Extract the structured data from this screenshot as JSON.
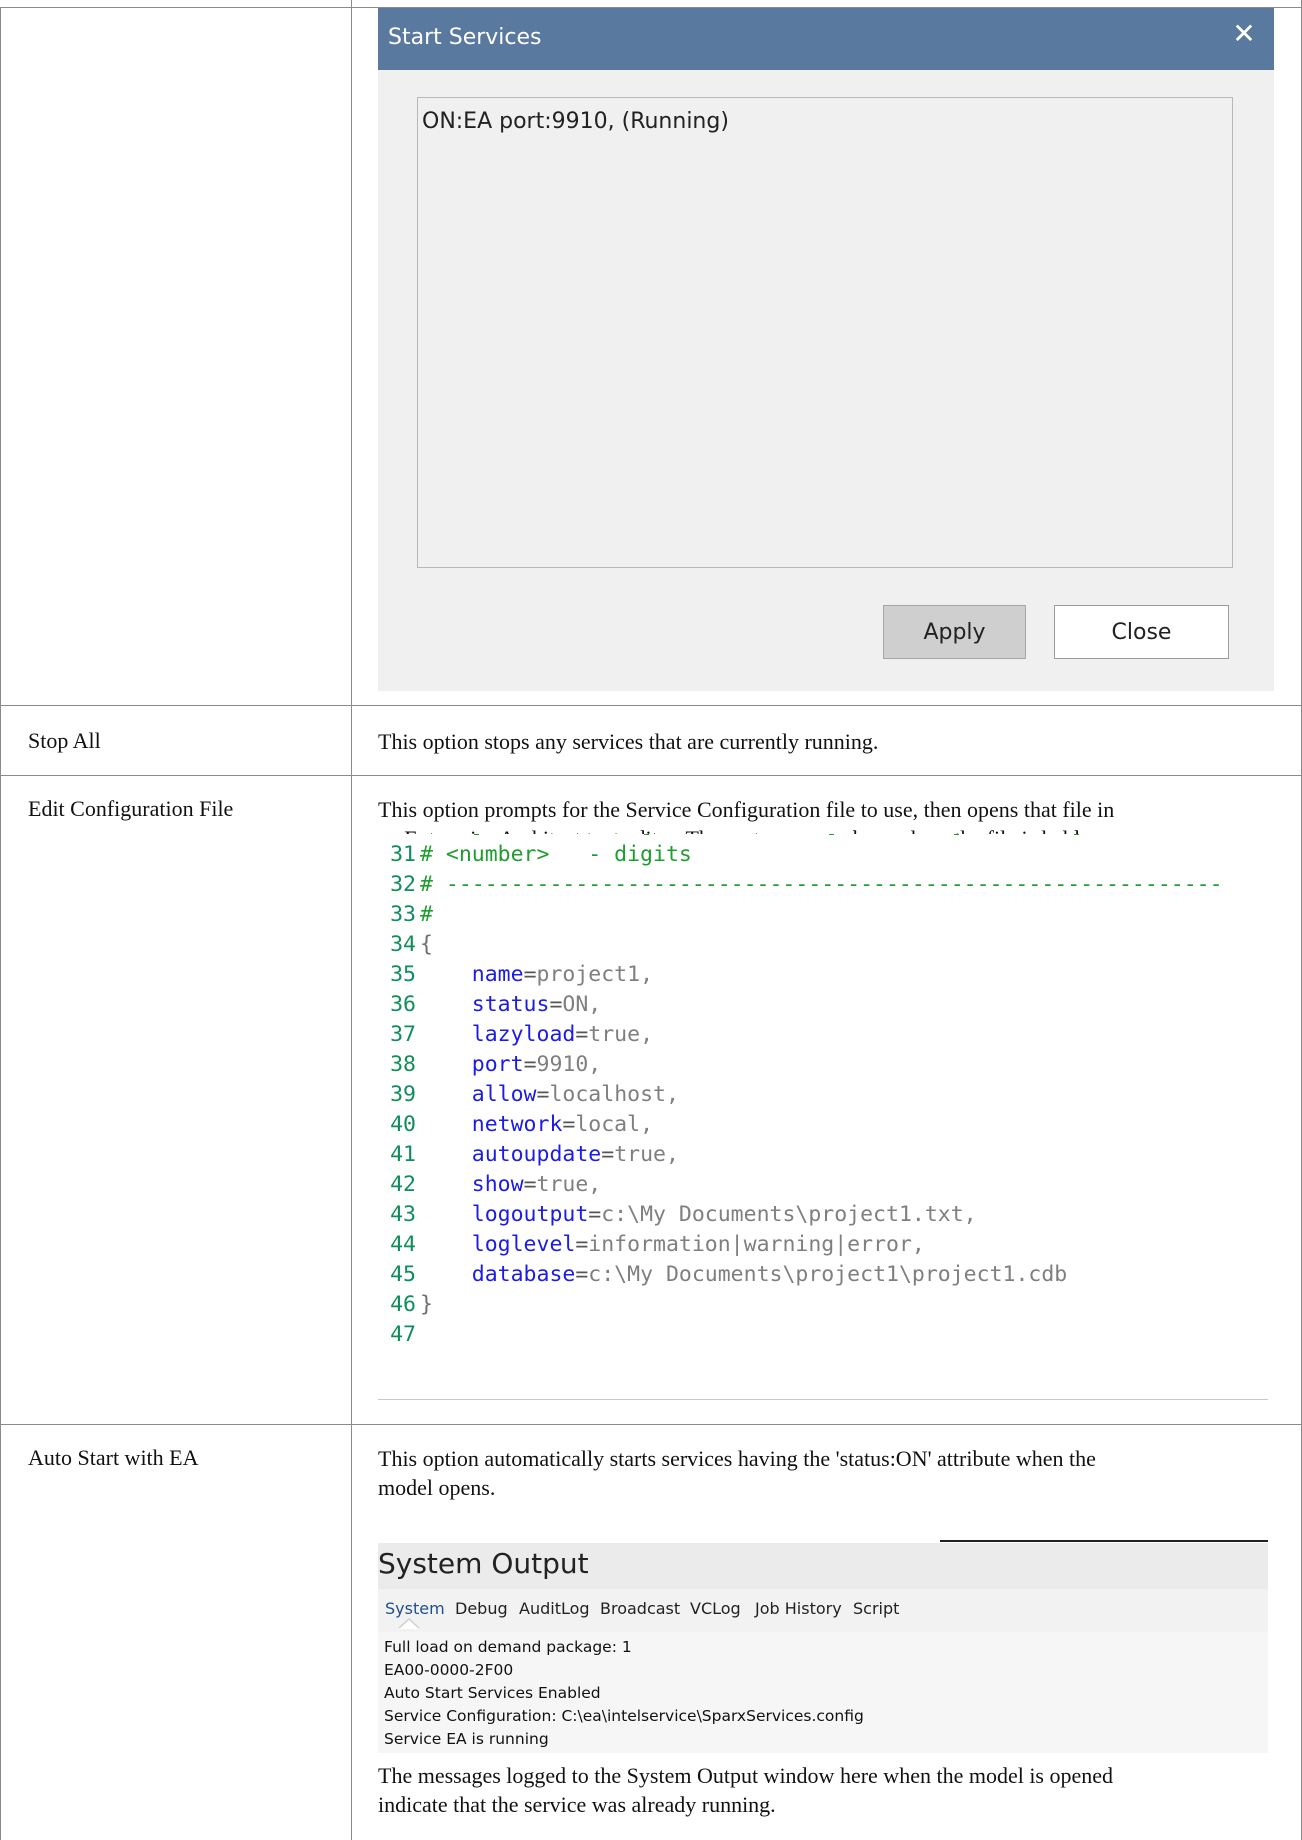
{
  "dialog": {
    "title": "Start Services",
    "close_glyph": "✕",
    "services": [
      "ON:EA port:9910, (Running)"
    ],
    "apply_label": "Apply",
    "close_label": "Close"
  },
  "rows": [
    {
      "label": "Stop All",
      "text": "This option stops any services that are currently running."
    },
    {
      "label": "Edit Configuration File",
      "text_lines": [
        "This option prompts for the Service Configuration file to use, then opens that file in",
        "an Enterprise Architect text editor. The system remembers where the file is held."
      ]
    },
    {
      "label": "Auto Start with EA",
      "text_lines": [
        "This option automatically starts services having the 'status:ON' attribute when the",
        "model opens."
      ],
      "after_lines": [
        "The messages logged to the System Output window here when the model is opened",
        "indicate that the service was already running."
      ]
    }
  ],
  "code": {
    "comment_lines": [
      {
        "num": "31",
        "text": "# <number>   - digits"
      },
      {
        "num": "32",
        "text": "# ------------------------------------------------------------"
      },
      {
        "num": "33",
        "text": "#"
      }
    ],
    "open_brace": {
      "num": "34",
      "text": "{"
    },
    "properties": [
      {
        "num": "35",
        "key": "name",
        "value": "project1,"
      },
      {
        "num": "36",
        "key": "status",
        "value": "ON,"
      },
      {
        "num": "37",
        "key": "lazyload",
        "value": "true,"
      },
      {
        "num": "38",
        "key": "port",
        "value": "9910,"
      },
      {
        "num": "39",
        "key": "allow",
        "value": "localhost,"
      },
      {
        "num": "40",
        "key": "network",
        "value": "local,"
      },
      {
        "num": "41",
        "key": "autoupdate",
        "value": "true,"
      },
      {
        "num": "42",
        "key": "show",
        "value": "true,"
      },
      {
        "num": "43",
        "key": "logoutput",
        "value": "c:\\My Documents\\project1.txt,"
      },
      {
        "num": "44",
        "key": "loglevel",
        "value": "information|warning|error,"
      },
      {
        "num": "45",
        "key": "database",
        "value": "c:\\My Documents\\project1\\project1.cdb"
      }
    ],
    "close_brace": {
      "num": "46",
      "text": "}"
    },
    "last_line": {
      "num": "47"
    }
  },
  "system_output": {
    "title": "System Output",
    "tabs": [
      "System",
      "Debug",
      "AuditLog",
      "Broadcast",
      "VCLog",
      "Job History",
      "Script"
    ],
    "active_tab": "System",
    "log_lines": [
      "Full load on demand package: 1",
      "EA00-0000-2F00",
      "Auto Start Services Enabled",
      "Service Configuration: C:\\ea\\intelservice\\SparxServices.config",
      "Service EA is running"
    ]
  }
}
